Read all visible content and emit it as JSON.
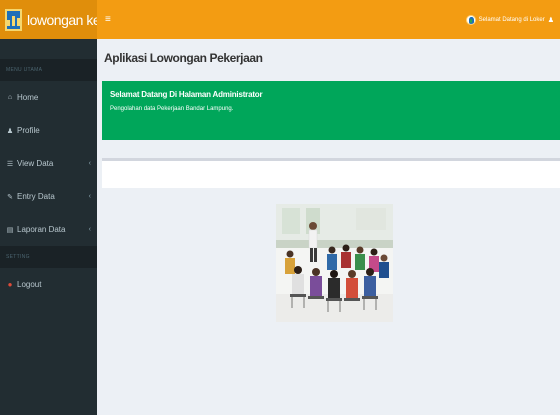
{
  "brand": {
    "name": "lowongan kerja"
  },
  "sidebar": {
    "header_main": "MENU UTAMA",
    "items": [
      {
        "label": "Home",
        "icon": "home-icon"
      },
      {
        "label": "Profile",
        "icon": "user-icon"
      },
      {
        "label": "View Data",
        "icon": "list-icon",
        "has_children": true
      },
      {
        "label": "Entry Data",
        "icon": "edit-icon",
        "has_children": true
      },
      {
        "label": "Laporan Data",
        "icon": "print-icon",
        "has_children": true
      }
    ],
    "header_setting": "SETTING",
    "logout_label": "Logout",
    "logout_icon": "logout-dot-icon"
  },
  "navbar": {
    "toggle_glyph": "≡",
    "user_greeting": "Selamat Datang di Loker"
  },
  "content": {
    "page_title": "Aplikasi Lowongan Pekerjaan",
    "callout_title": "Selamat Datang Di Halaman Administrator",
    "callout_text": "Pengolahan data Pekerjaan Bandar Lampung."
  },
  "colors": {
    "navbar": "#f39c12",
    "logo_bg": "#e08e0b",
    "sidebar": "#222d32",
    "callout": "#00a65a",
    "content_bg": "#ecf0f5"
  }
}
